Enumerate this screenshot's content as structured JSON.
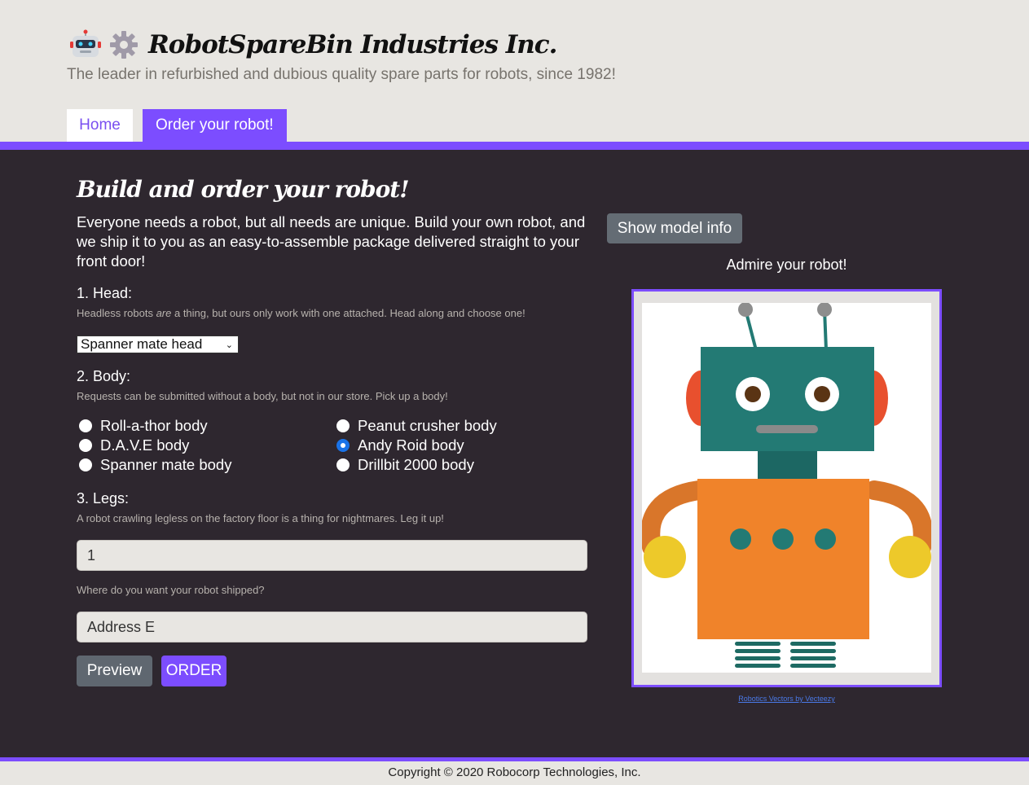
{
  "header": {
    "title": "RobotSpareBin Industries Inc.",
    "tagline": "The leader in refurbished and dubious quality spare parts for robots, since 1982!",
    "tabs": [
      {
        "label": "Home"
      },
      {
        "label": "Order your robot!"
      }
    ],
    "logo_icons": [
      "robot-emoji",
      "gear-emoji"
    ]
  },
  "main": {
    "heading": "Build and order your robot!",
    "intro": "Everyone needs a robot, but all needs are unique. Build your own robot, and we ship it to you as an easy-to-assemble package delivered straight to your front door!",
    "head": {
      "label": "1. Head:",
      "hint_before": "Headless robots ",
      "hint_emphasis": "are",
      "hint_after": " a thing, but ours only work with one attached. Head along and choose one!",
      "selected": "Spanner mate head"
    },
    "body": {
      "label": "2. Body:",
      "hint": "Requests can be submitted without a body, but not in our store. Pick up a body!",
      "options": [
        {
          "label": "Roll-a-thor body",
          "checked": false
        },
        {
          "label": "Peanut crusher body",
          "checked": false
        },
        {
          "label": "D.A.V.E body",
          "checked": false
        },
        {
          "label": "Andy Roid body",
          "checked": true
        },
        {
          "label": "Spanner mate body",
          "checked": false
        },
        {
          "label": "Drillbit 2000 body",
          "checked": false
        }
      ]
    },
    "legs": {
      "label": "3. Legs:",
      "hint": "A robot crawling legless on the factory floor is a thing for nightmares. Leg it up!",
      "value": "1"
    },
    "address": {
      "hint": "Where do you want your robot shipped?",
      "value": "Address E"
    },
    "buttons": {
      "preview": "Preview",
      "order": "ORDER",
      "model_info": "Show model info"
    },
    "preview_panel": {
      "caption": "Admire your robot!",
      "credit": "Robotics Vectors by Vecteezy"
    }
  },
  "footer": {
    "copyright": "Copyright © 2020 Robocorp Technologies, Inc."
  },
  "colors": {
    "accent": "#7c4dff",
    "main_bg": "#2e272f",
    "page_bg": "#e8e6e2",
    "radio_checked": "#1a73e8"
  }
}
